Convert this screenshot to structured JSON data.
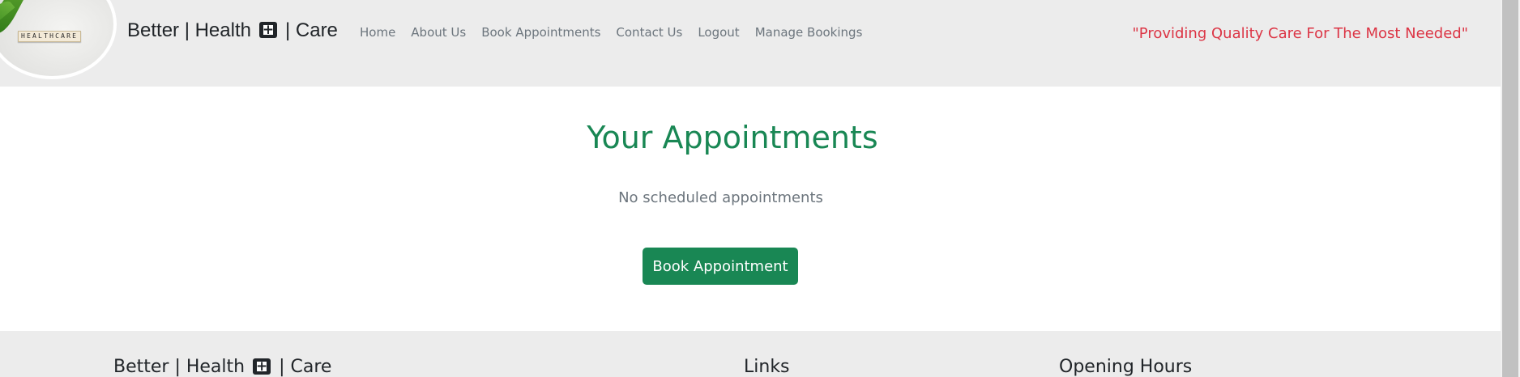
{
  "header": {
    "logo_text": "HEALTHCARE",
    "brand_part1": "Better | Health",
    "brand_part2": "| Care",
    "nav": [
      {
        "label": "Home"
      },
      {
        "label": "About Us"
      },
      {
        "label": "Book Appointments"
      },
      {
        "label": "Contact Us"
      },
      {
        "label": "Logout"
      },
      {
        "label": "Manage Bookings"
      }
    ],
    "tagline": "\"Providing Quality Care For The Most Needed\""
  },
  "main": {
    "title": "Your Appointments",
    "empty_message": "No scheduled appointments",
    "book_button": "Book Appointment"
  },
  "footer": {
    "brand_part1": "Better | Health",
    "brand_part2": "| Care",
    "links_heading": "Links",
    "hours_heading": "Opening Hours"
  },
  "colors": {
    "accent_green": "#198754",
    "tagline_red": "#dc3545",
    "header_bg": "#ececec"
  },
  "icons": {
    "brand_icon": "medical-kit-icon"
  }
}
